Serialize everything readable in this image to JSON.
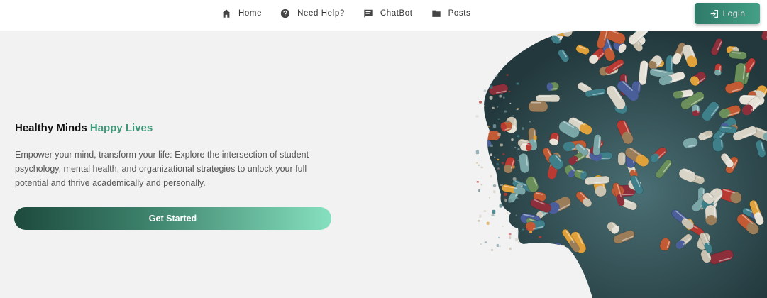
{
  "nav": {
    "items": [
      {
        "label": "Home",
        "icon": "home-icon"
      },
      {
        "label": "Need Help?",
        "icon": "help-icon"
      },
      {
        "label": "ChatBot",
        "icon": "chat-icon"
      },
      {
        "label": "Posts",
        "icon": "folder-icon"
      }
    ],
    "login_label": "Login"
  },
  "hero": {
    "title_main": "Healthy Minds",
    "title_accent": "Happy Lives",
    "description": "Empower your mind, transform your life: Explore the intersection of student psychology, mental health, and organizational strategies to unlock your full potential and thrive academically and personally.",
    "cta_label": "Get Started",
    "image_subject": "head-silhouette-made-of-pills"
  },
  "colors": {
    "accent": "#3d9a78",
    "login_bg": "#2f7a69",
    "cta_start": "#1d4a3d",
    "cta_end": "#86e0bf",
    "page_bg": "#f2f2f2"
  }
}
